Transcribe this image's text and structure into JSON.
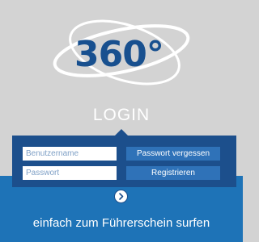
{
  "logo": {
    "text": "360°"
  },
  "login": {
    "title": "LOGIN"
  },
  "form": {
    "username_placeholder": "Benutzername",
    "username_value": "",
    "password_placeholder": "Passwort",
    "password_value": "",
    "forgot_label": "Passwort vergessen",
    "register_label": "Registrieren",
    "submit_icon": "chevron-right-icon"
  },
  "footer": {
    "tagline": "einfach zum Führerschein surfen"
  },
  "colors": {
    "background": "#d3d3d3",
    "brand_blue": "#1e73b7",
    "panel_blue": "#1c4f8c",
    "button_blue": "#2f72b8",
    "logo_blue": "#18508f"
  }
}
